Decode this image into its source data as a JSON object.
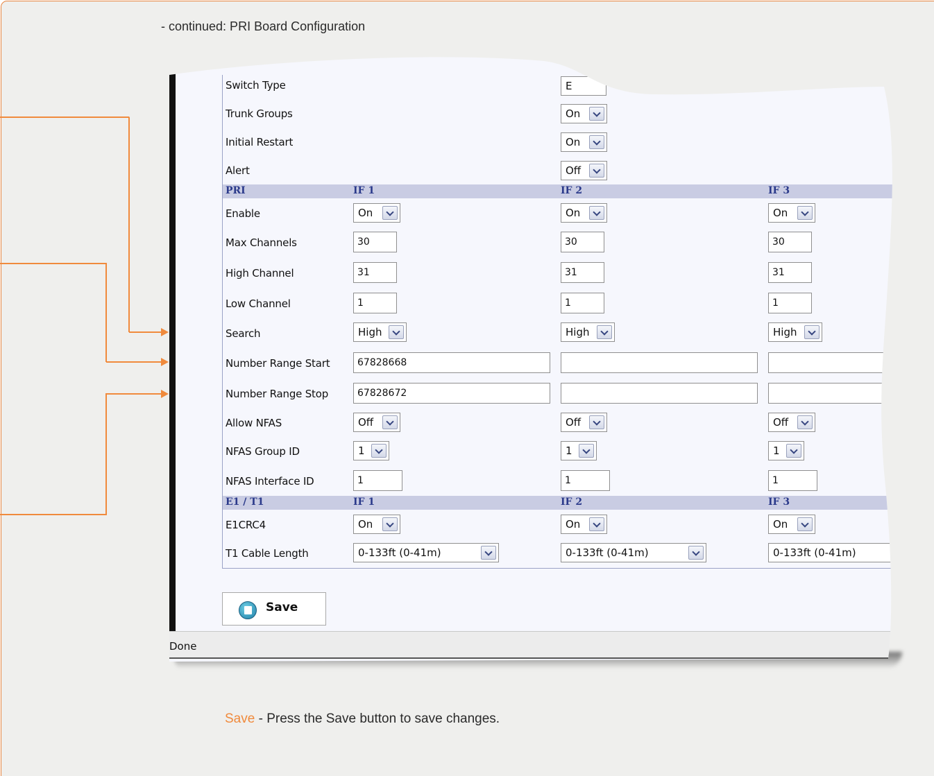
{
  "caption": "- continued: PRI Board Configuration",
  "footnote": {
    "term": "Save",
    "text": " - Press the Save button to save changes."
  },
  "top_rows": [
    {
      "label": "Switch Type",
      "value": "E"
    },
    {
      "label": "Trunk Groups",
      "value": "On"
    },
    {
      "label": "Initial Restart",
      "value": "On"
    },
    {
      "label": "Alert",
      "value": "Off"
    }
  ],
  "pri_section": {
    "title": "PRI",
    "interfaces": [
      "IF 1",
      "IF 2",
      "IF 3"
    ]
  },
  "pri_rows": {
    "enable": {
      "label": "Enable",
      "values": [
        "On",
        "On",
        "On"
      ]
    },
    "max_channels": {
      "label": "Max Channels",
      "values": [
        "30",
        "30",
        "30"
      ]
    },
    "high_channel": {
      "label": "High Channel",
      "values": [
        "31",
        "31",
        "31"
      ]
    },
    "low_channel": {
      "label": "Low Channel",
      "values": [
        "1",
        "1",
        "1"
      ]
    },
    "search": {
      "label": "Search",
      "values": [
        "High",
        "High",
        "High"
      ]
    },
    "number_range_start": {
      "label": "Number Range Start",
      "values": [
        "67828668",
        "",
        ""
      ]
    },
    "number_range_stop": {
      "label": "Number Range Stop",
      "values": [
        "67828672",
        "",
        ""
      ]
    },
    "allow_nfas": {
      "label": "Allow NFAS",
      "values": [
        "Off",
        "Off",
        "Off"
      ]
    },
    "nfas_group_id": {
      "label": "NFAS Group ID",
      "values": [
        "1",
        "1",
        "1"
      ]
    },
    "nfas_interface_id": {
      "label": "NFAS Interface ID",
      "values": [
        "1",
        "1",
        "1"
      ]
    }
  },
  "e1t1_section": {
    "title": "E1 / T1",
    "interfaces": [
      "IF 1",
      "IF 2",
      "IF 3"
    ]
  },
  "e1t1_rows": {
    "e1crc4": {
      "label": "E1CRC4",
      "values": [
        "On",
        "On",
        "On"
      ]
    },
    "t1_cable_length": {
      "label": "T1 Cable Length",
      "values": [
        "0-133ft (0-41m)",
        "0-133ft (0-41m)",
        "0-133ft (0-41m)"
      ]
    }
  },
  "save_button": {
    "label": "Save"
  },
  "status": "Done",
  "colors": {
    "accent": "#f08a3c",
    "section_header": "#c9cce3",
    "section_text": "#2b3a8b"
  }
}
